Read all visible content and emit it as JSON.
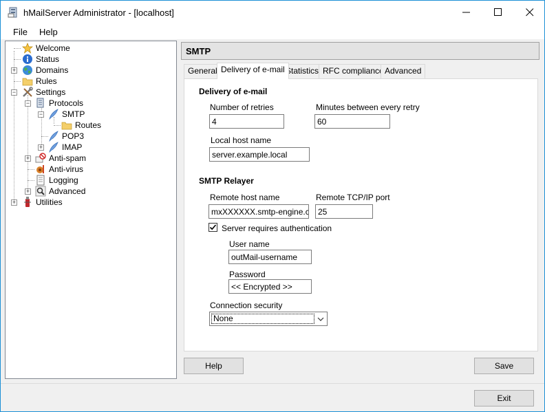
{
  "window": {
    "title": "hMailServer Administrator - [localhost]",
    "accent": "#1a8fd6"
  },
  "menu": {
    "items": [
      "File",
      "Help"
    ]
  },
  "tree": {
    "welcome": "Welcome",
    "status": "Status",
    "domains": "Domains",
    "rules": "Rules",
    "settings": "Settings",
    "protocols": "Protocols",
    "smtp": "SMTP",
    "routes": "Routes",
    "pop3": "POP3",
    "imap": "IMAP",
    "antispam": "Anti-spam",
    "antivirus": "Anti-virus",
    "logging": "Logging",
    "advanced": "Advanced",
    "utilities": "Utilities"
  },
  "header": {
    "title": "SMTP"
  },
  "tabs": [
    {
      "label": "General",
      "active": false
    },
    {
      "label": "Delivery of e-mail",
      "active": true
    },
    {
      "label": "Statistics",
      "active": false
    },
    {
      "label": "RFC compliance",
      "active": false
    },
    {
      "label": "Advanced",
      "active": false
    }
  ],
  "delivery": {
    "group_title": "Delivery of e-mail",
    "retries_label": "Number of retries",
    "retries_value": "4",
    "minutes_label": "Minutes between every retry",
    "minutes_value": "60",
    "hostname_label": "Local host name",
    "hostname_value": "server.example.local"
  },
  "relayer": {
    "group_title": "SMTP Relayer",
    "remote_host_label": "Remote host name",
    "remote_host_value": "mxXXXXXX.smtp-engine.com",
    "remote_port_label": "Remote TCP/IP port",
    "remote_port_value": "25",
    "auth_label": "Server requires authentication",
    "auth_checked": true,
    "username_label": "User name",
    "username_value": "outMail-username",
    "password_label": "Password",
    "password_value": "<< Encrypted >>",
    "security_label": "Connection security",
    "security_value": "None"
  },
  "buttons": {
    "help": "Help",
    "save": "Save",
    "exit": "Exit"
  }
}
